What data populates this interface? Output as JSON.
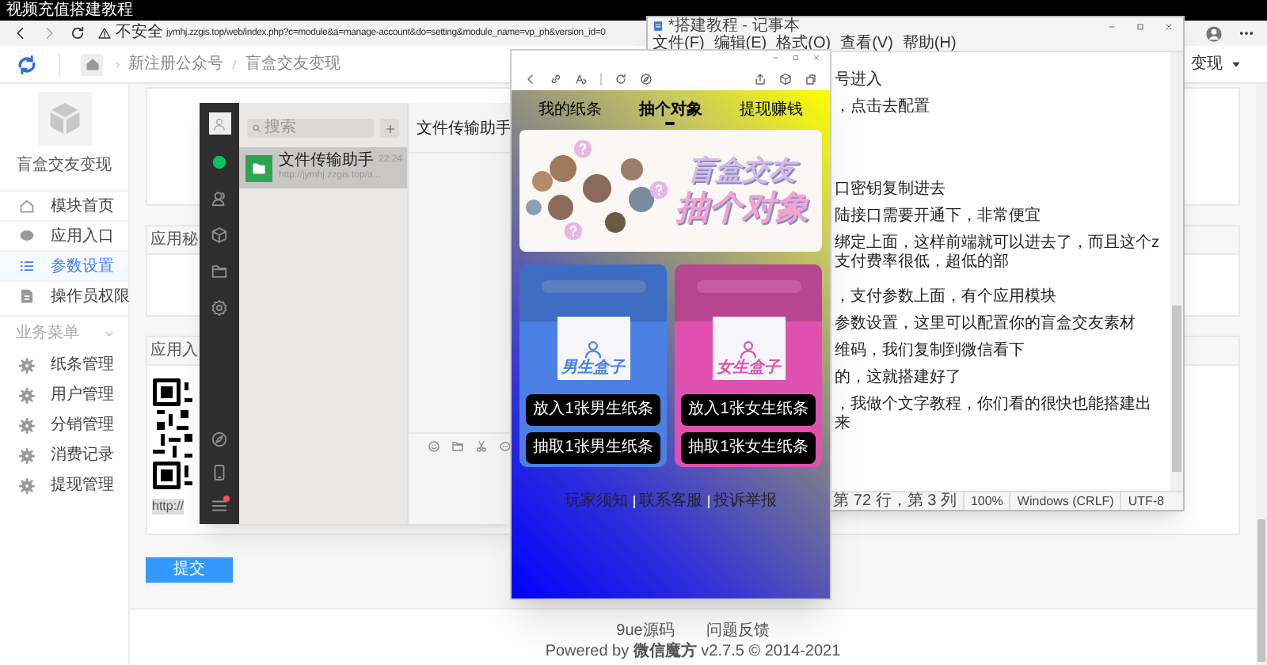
{
  "recording_title": "视频充值搭建教程",
  "browser": {
    "security": "不安全",
    "url": "jymhj.zzgis.top/web/index.php?c=module&a=manage-account&do=setting&module_name=vp_ph&version_id=0"
  },
  "header": {
    "breadcrumb": [
      "新注册公众号",
      "盲盒交友变现"
    ],
    "account": "变现"
  },
  "sidebar": {
    "module_name": "盲盒交友变现",
    "items": [
      {
        "label": "模块首页",
        "kind": "home",
        "selected": false
      },
      {
        "label": "应用入口",
        "kind": "bubble",
        "selected": false
      },
      {
        "label": "参数设置",
        "kind": "list",
        "selected": true
      },
      {
        "label": "操作员权限",
        "kind": "doc",
        "selected": false
      }
    ],
    "section": "业务菜单",
    "section_items": [
      {
        "label": "纸条管理",
        "kind": "gear",
        "selected": false
      },
      {
        "label": "用户管理",
        "kind": "gear",
        "selected": false
      },
      {
        "label": "分销管理",
        "kind": "gear",
        "selected": false
      },
      {
        "label": "消费记录",
        "kind": "gear",
        "selected": false
      },
      {
        "label": "提现管理",
        "kind": "gear",
        "selected": false
      }
    ]
  },
  "cards": [
    {
      "title": "应用秘"
    },
    {
      "title": "应用入",
      "link": "http://"
    }
  ],
  "submit": "提交",
  "footer": {
    "links": [
      "9ue源码",
      "问题反馈"
    ],
    "powered": "Powered by **微信魔方** v2.7.5 © 2014-2021"
  },
  "wechat": {
    "nav": [
      {
        "kind": "chat",
        "selected": true
      },
      {
        "kind": "contacts",
        "selected": false
      },
      {
        "kind": "cube",
        "selected": false
      },
      {
        "kind": "folder",
        "selected": false
      },
      {
        "kind": "settings",
        "selected": false
      }
    ],
    "search": {
      "placeholder": "搜索"
    },
    "chats": [
      {
        "name": "文件传输助手",
        "time": "22:24",
        "preview": "http://jymhj.zzgis.top/a...",
        "selected": true
      }
    ],
    "title": "文件传输助手",
    "menu_unread": true
  },
  "phone": {
    "tabs": [
      {
        "label": "我的纸条",
        "selected": false
      },
      {
        "label": "抽个对象",
        "selected": true
      },
      {
        "label": "提现赚钱",
        "selected": false
      }
    ],
    "banner": {
      "line1": "盲盒交友",
      "line2": "抽个对象"
    },
    "boxes": [
      {
        "kind": "male",
        "label": "男生盒子",
        "buttons": [
          "放入1张男生纸条",
          "抽取1张男生纸条"
        ]
      },
      {
        "kind": "female",
        "label": "女生盒子",
        "buttons": [
          "放入1张女生纸条",
          "抽取1张女生纸条"
        ]
      }
    ],
    "footer_links": [
      "玩家须知",
      "联系客服",
      "投诉举报"
    ]
  },
  "notepad": {
    "title": "*搭建教程 - 记事本",
    "menu": [
      "文件(F)",
      "编辑(E)",
      "格式(O)",
      "查看(V)",
      "帮助(H)"
    ],
    "blocks": [
      [
        "号进入",
        "，点击去配置"
      ],
      [
        "口密钥复制进去",
        "陆接口需要开通下，非常便宜",
        "绑定上面，这样前端就可以进去了，而且这个z支付费率很低，超低的部"
      ],
      [
        "，支付参数上面，有个应用模块",
        "参数设置，这里可以配置你的盲盒交友素材",
        "维码，我们复制到微信看下",
        "的，这就搭建好了",
        "，我做个文字教程，你们看的很快也能搭建出来"
      ]
    ],
    "status": [
      "第 72 行，第 3 列",
      "100%",
      "Windows (CRLF)",
      "UTF-8"
    ]
  }
}
